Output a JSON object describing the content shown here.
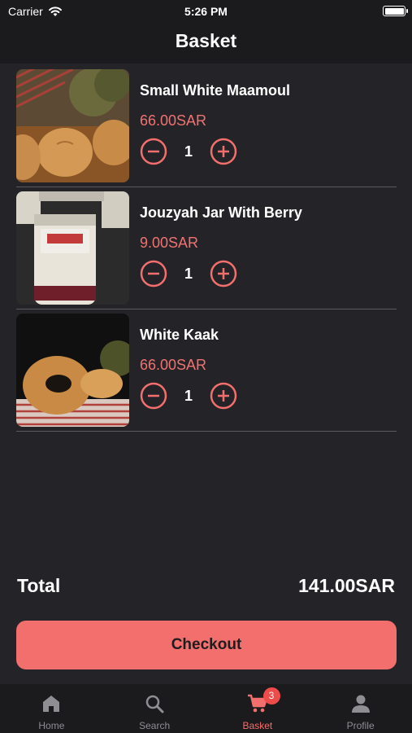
{
  "status_bar": {
    "carrier": "Carrier",
    "time": "5:26 PM"
  },
  "header": {
    "title": "Basket"
  },
  "basket": {
    "items": [
      {
        "name": "Small White Maamoul",
        "price": "66.00SAR",
        "quantity": "1"
      },
      {
        "name": "Jouzyah Jar With Berry",
        "price": "9.00SAR",
        "quantity": "1"
      },
      {
        "name": "White Kaak",
        "price": "66.00SAR",
        "quantity": "1"
      }
    ]
  },
  "summary": {
    "total_label": "Total",
    "total_value": "141.00SAR",
    "checkout_label": "Checkout"
  },
  "tabbar": {
    "tabs": [
      {
        "label": "Home",
        "icon": "home-icon"
      },
      {
        "label": "Search",
        "icon": "search-icon"
      },
      {
        "label": "Basket",
        "icon": "cart-icon",
        "badge": "3",
        "active": true
      },
      {
        "label": "Profile",
        "icon": "person-icon"
      }
    ]
  },
  "colors": {
    "accent": "#f26f6e",
    "background": "#242428",
    "bar": "#1b1b1d",
    "badge": "#ee4b4b"
  }
}
